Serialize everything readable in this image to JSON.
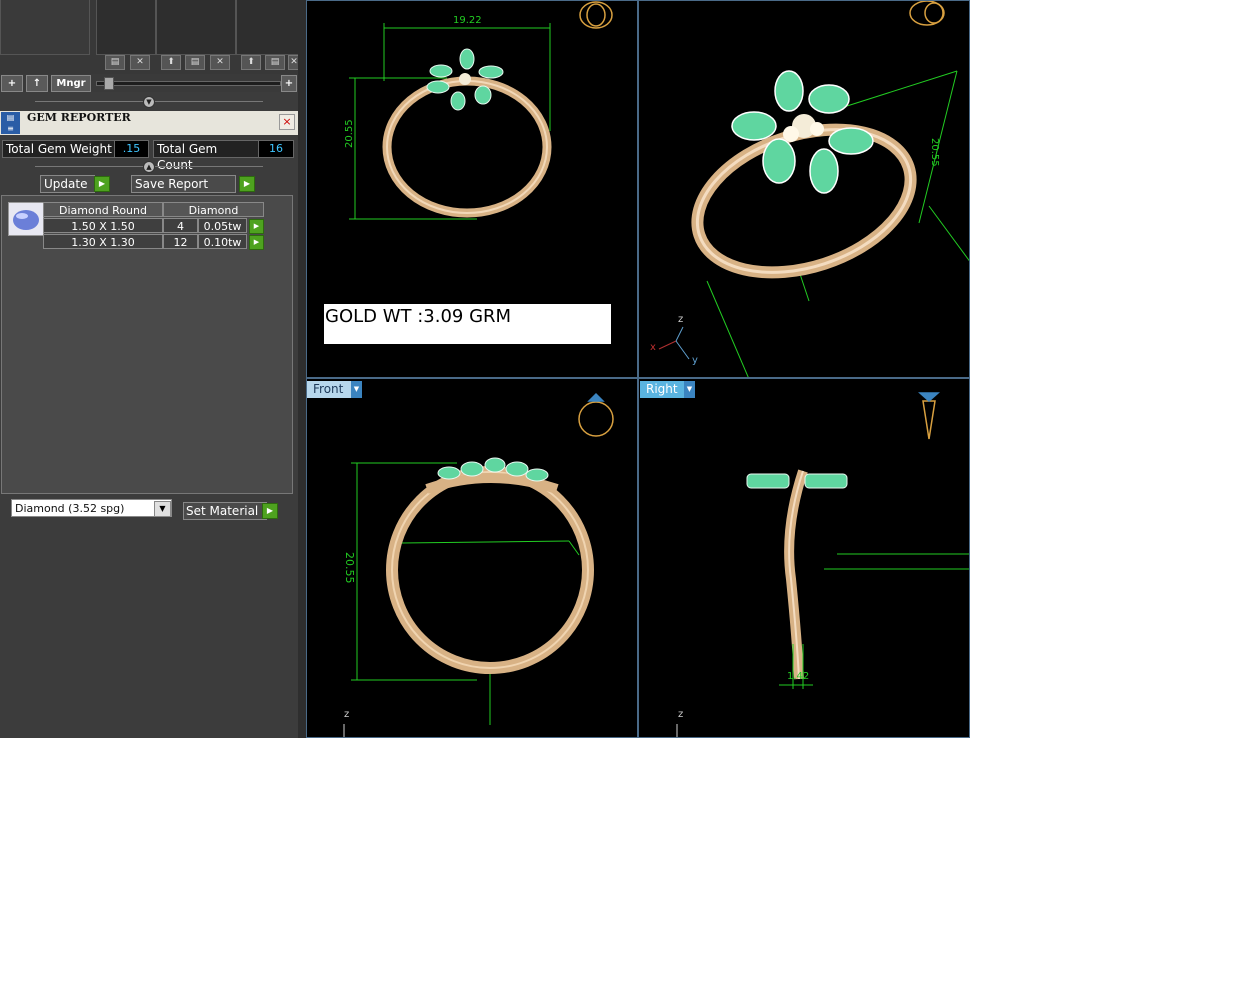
{
  "toolbar": {
    "add_label": "+",
    "up_label": "↑",
    "manager_label": "Mngr",
    "zoom_plus": "+"
  },
  "gem_reporter": {
    "title": "GEM REPORTER",
    "close": "×",
    "total_weight_label": "Total Gem Weight",
    "total_weight_value": ".15",
    "total_count_label": "Total Gem Count",
    "total_count_value": "16",
    "update_label": "Update",
    "save_label": "Save Report",
    "table_headers": [
      "Diamond Round",
      "Diamond"
    ],
    "rows": [
      {
        "size": "1.50 X 1.50",
        "count": "4",
        "weight": "0.05tw"
      },
      {
        "size": "1.30 X 1.30",
        "count": "12",
        "weight": "0.10tw"
      }
    ],
    "material_select": "Diamond     (3.52 spg)",
    "set_material_label": "Set Material"
  },
  "viewports": {
    "top_left": {
      "gold_weight": "GOLD WT :3.09 GRM",
      "dim_width": "19.22",
      "dim_height": "20.55"
    },
    "top_right": {
      "dim_height": "20.55",
      "axis_z": "z",
      "axis_x": "x",
      "axis_y": "y"
    },
    "bottom_left": {
      "label": "Front",
      "dim_height": "20.55",
      "axis_z": "z"
    },
    "bottom_right": {
      "label": "Right",
      "dim_thickness": "1.42",
      "axis_z": "z"
    }
  },
  "colors": {
    "gold": "#d8b285",
    "gem_green": "#5fd6a0",
    "dimension_green": "#22cc22",
    "accent_blue": "#5ab4e0"
  }
}
